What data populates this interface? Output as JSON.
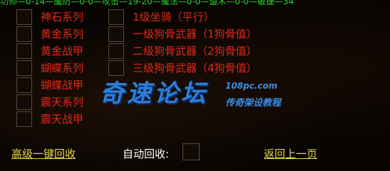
{
  "top_status": "功师—0-14—魔防—0-0—攻击—19-20—魔法—0-0—道术—0-0—敏捷—34",
  "left_column": [
    "神石系列",
    "黄金系列",
    "黄金战甲",
    "蝴蝶系列",
    "蝴蝶战甲",
    "震天系列",
    "震天战甲"
  ],
  "right_column": [
    "1级坐骑（平行）",
    "一级狗骨武器（1狗骨值）",
    "二级狗骨武器（2狗骨值）",
    "三级狗骨武器（4狗骨值）"
  ],
  "watermark": {
    "name": "奇速论坛",
    "site": "108pc.com",
    "slogan": "传奇架设教程"
  },
  "bottom": {
    "one_click_recycle": "高级一键回收",
    "auto_recycle_label": "自动回收:",
    "back_link": "返回上一页"
  }
}
